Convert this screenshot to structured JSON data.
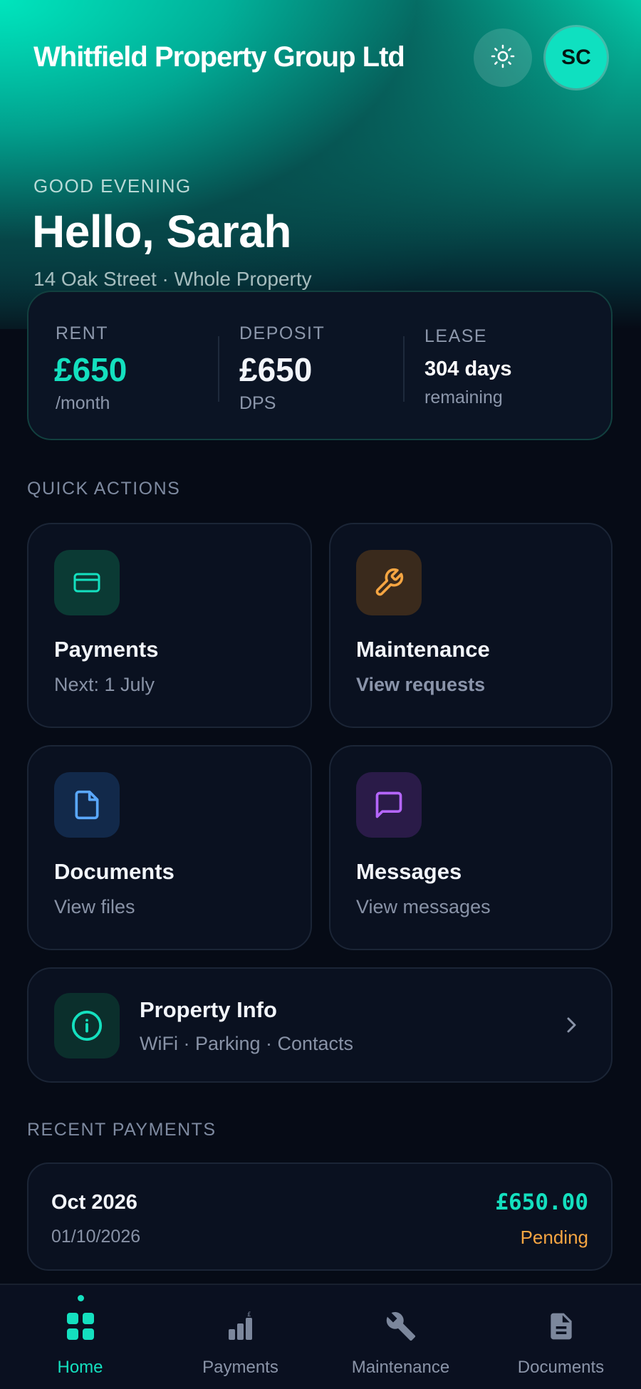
{
  "header": {
    "brand": "Whitfield Property Group Ltd",
    "avatar_initials": "SC",
    "theme_icon": "sun-icon"
  },
  "greeting": {
    "label": "GOOD EVENING",
    "name": "Hello, Sarah",
    "address": "14 Oak Street · Whole Property"
  },
  "summary": {
    "rent": {
      "label": "RENT",
      "value": "£650",
      "sub": "/month"
    },
    "deposit": {
      "label": "DEPOSIT",
      "value": "£650",
      "sub": "DPS"
    },
    "lease": {
      "label": "LEASE",
      "value": "304 days",
      "sub": "remaining"
    }
  },
  "quick_actions": {
    "label": "QUICK ACTIONS",
    "items": [
      {
        "title": "Payments",
        "sub": "Next: 1 July",
        "icon": "card-icon"
      },
      {
        "title": "Maintenance",
        "sub": "View requests",
        "icon": "wrench-icon"
      },
      {
        "title": "Documents",
        "sub": "View files",
        "icon": "document-icon"
      },
      {
        "title": "Messages",
        "sub": "View messages",
        "icon": "chat-icon"
      }
    ]
  },
  "property_info": {
    "title": "Property Info",
    "sub": "WiFi · Parking · Contacts",
    "icon": "info-icon"
  },
  "recent_payments": {
    "label": "RECENT PAYMENTS",
    "items": [
      {
        "period": "Oct 2026",
        "date": "01/10/2026",
        "amount": "£650.00",
        "status": "Pending"
      }
    ]
  },
  "nav": {
    "items": [
      {
        "label": "Home",
        "icon": "home-grid-icon",
        "active": true
      },
      {
        "label": "Payments",
        "icon": "chart-pound-icon"
      },
      {
        "label": "Maintenance",
        "icon": "wrench-icon"
      },
      {
        "label": "Documents",
        "icon": "document-icon"
      }
    ]
  },
  "colors": {
    "accent": "#14e0bf",
    "pending": "#f5a542",
    "background": "#060b16"
  }
}
